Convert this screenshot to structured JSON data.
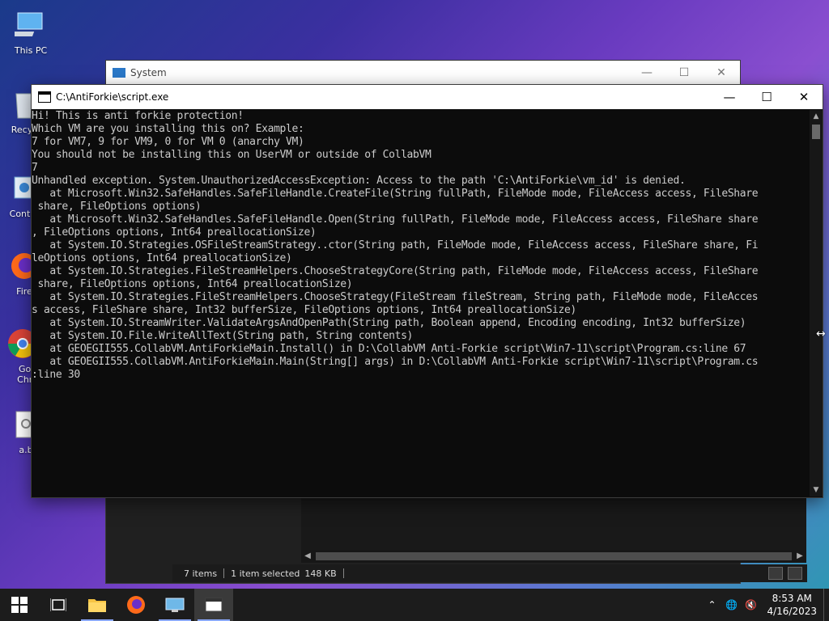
{
  "desktop": {
    "icons": [
      {
        "label": "This PC"
      },
      {
        "label": "Recyc"
      },
      {
        "label": "Contro"
      },
      {
        "label": "Fire"
      },
      {
        "label": "Goo Chro"
      },
      {
        "label": "a.b"
      }
    ]
  },
  "system_window": {
    "title": "System",
    "status": {
      "items": "7 items",
      "selected": "1 item selected",
      "size": "148 KB"
    }
  },
  "console_window": {
    "title": "C:\\AntiForkie\\script.exe",
    "lines": [
      "Hi! This is anti forkie protection!",
      "Which VM are you installing this on? Example:",
      "7 for VM7, 9 for VM9, 0 for VM 0 (anarchy VM)",
      "You should not be installing this on UserVM or outside of CollabVM",
      "7",
      "Unhandled exception. System.UnauthorizedAccessException: Access to the path 'C:\\AntiForkie\\vm_id' is denied.",
      "   at Microsoft.Win32.SafeHandles.SafeFileHandle.CreateFile(String fullPath, FileMode mode, FileAccess access, FileShare",
      " share, FileOptions options)",
      "   at Microsoft.Win32.SafeHandles.SafeFileHandle.Open(String fullPath, FileMode mode, FileAccess access, FileShare share",
      ", FileOptions options, Int64 preallocationSize)",
      "   at System.IO.Strategies.OSFileStreamStrategy..ctor(String path, FileMode mode, FileAccess access, FileShare share, Fi",
      "leOptions options, Int64 preallocationSize)",
      "   at System.IO.Strategies.FileStreamHelpers.ChooseStrategyCore(String path, FileMode mode, FileAccess access, FileShare",
      " share, FileOptions options, Int64 preallocationSize)",
      "   at System.IO.Strategies.FileStreamHelpers.ChooseStrategy(FileStream fileStream, String path, FileMode mode, FileAcces",
      "s access, FileShare share, Int32 bufferSize, FileOptions options, Int64 preallocationSize)",
      "   at System.IO.StreamWriter.ValidateArgsAndOpenPath(String path, Boolean append, Encoding encoding, Int32 bufferSize)",
      "   at System.IO.File.WriteAllText(String path, String contents)",
      "   at GEOEGII555.CollabVM.AntiForkieMain.Install() in D:\\CollabVM Anti-Forkie script\\Win7-11\\script\\Program.cs:line 67",
      "   at GEOEGII555.CollabVM.AntiForkieMain.Main(String[] args) in D:\\CollabVM Anti-Forkie script\\Win7-11\\script\\Program.cs",
      ":line 30"
    ]
  },
  "taskbar": {
    "time": "8:53 AM",
    "date": "4/16/2023"
  },
  "colors": {
    "console_bg": "#0c0c0c",
    "console_text": "#cccccc",
    "taskbar": "#1c1c1c",
    "accent": "#8aa8ff"
  },
  "icons": [
    "start-icon",
    "task-view-icon",
    "file-explorer-icon",
    "firefox-icon",
    "remote-desktop-icon",
    "console-app-icon",
    "chevron-up-icon",
    "network-icon",
    "volume-muted-icon"
  ]
}
